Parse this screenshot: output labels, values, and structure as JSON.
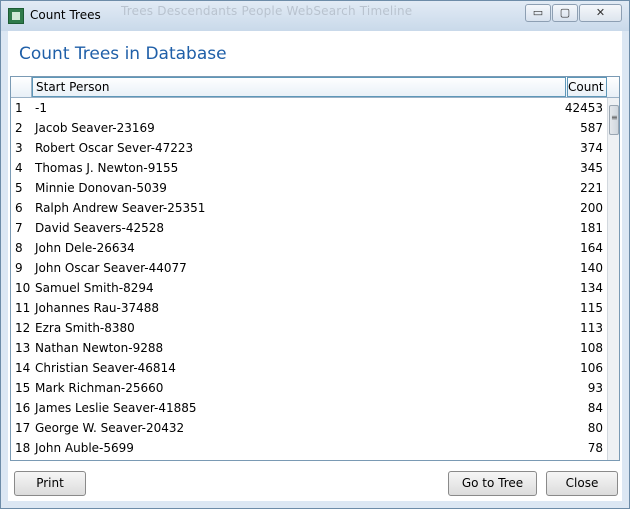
{
  "window": {
    "title": "Count Trees",
    "ghost_menu": "Trees  Descendants  People  WebSearch  Timeline",
    "controls": {
      "minimize": "▭",
      "maximize": "▢",
      "close": "✕"
    }
  },
  "dialog": {
    "heading": "Count Trees in Database",
    "columns": {
      "person": "Start Person",
      "count": "Count"
    },
    "rows": [
      {
        "num": "1",
        "person": "-1",
        "count": "42453"
      },
      {
        "num": "2",
        "person": "Jacob Seaver-23169",
        "count": "587"
      },
      {
        "num": "3",
        "person": "Robert Oscar Sever-47223",
        "count": "374"
      },
      {
        "num": "4",
        "person": "Thomas J. Newton-9155",
        "count": "345"
      },
      {
        "num": "5",
        "person": "Minnie Donovan-5039",
        "count": "221"
      },
      {
        "num": "6",
        "person": "Ralph Andrew Seaver-25351",
        "count": "200"
      },
      {
        "num": "7",
        "person": "David Seavers-42528",
        "count": "181"
      },
      {
        "num": "8",
        "person": "John Dele-26634",
        "count": "164"
      },
      {
        "num": "9",
        "person": "John Oscar Seaver-44077",
        "count": "140"
      },
      {
        "num": "10",
        "person": "Samuel Smith-8294",
        "count": "134"
      },
      {
        "num": "11",
        "person": "Johannes Rau-37488",
        "count": "115"
      },
      {
        "num": "12",
        "person": "Ezra Smith-8380",
        "count": "113"
      },
      {
        "num": "13",
        "person": "Nathan Newton-9288",
        "count": "108"
      },
      {
        "num": "14",
        "person": "Christian Seaver-46814",
        "count": "106"
      },
      {
        "num": "15",
        "person": "Mark Richman-25660",
        "count": "93"
      },
      {
        "num": "16",
        "person": "James Leslie Seaver-41885",
        "count": "84"
      },
      {
        "num": "17",
        "person": "George W. Seaver-20432",
        "count": "80"
      },
      {
        "num": "18",
        "person": "John Auble-5699",
        "count": "78"
      }
    ],
    "buttons": {
      "print": "Print",
      "goto": "Go to Tree",
      "close": "Close"
    }
  }
}
